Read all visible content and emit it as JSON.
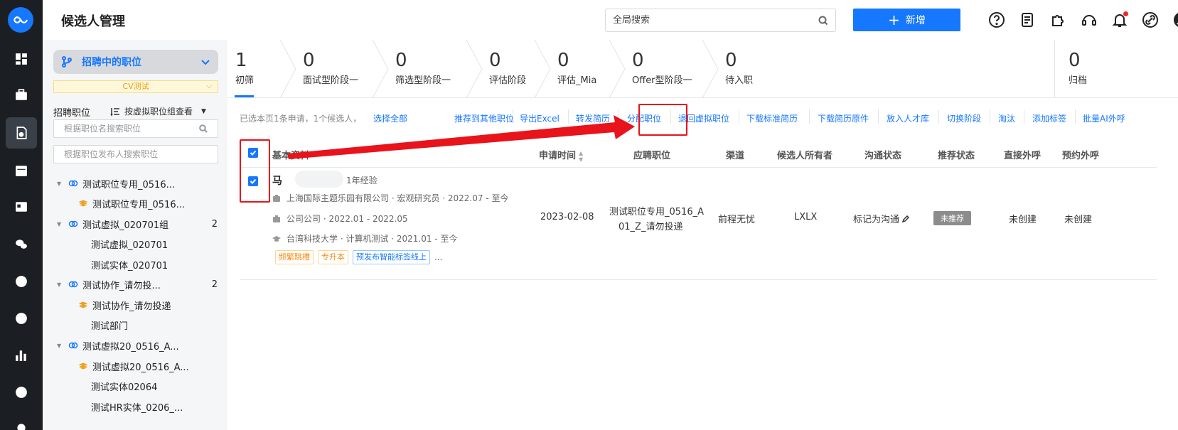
{
  "header": {
    "title": "候选人管理",
    "search_placeholder": "全局搜索",
    "add_label": "新增"
  },
  "left_panel": {
    "position_select": "招聘中的职位",
    "cv_tag": "CV测试",
    "section_label": "招聘职位",
    "group_view": "按虚拟职位组查看",
    "search_name_placeholder": "根据职位名搜索职位",
    "search_publisher_placeholder": "根据职位发布人搜索职位",
    "tree": [
      {
        "label": "测试职位专用_0516...",
        "count": ""
      },
      {
        "label": "测试职位专用_0516...",
        "count": ""
      },
      {
        "label": "测试虚拟_020701组",
        "count": "2"
      },
      {
        "label": "测试虚拟_020701",
        "count": ""
      },
      {
        "label": "测试实体_020701",
        "count": ""
      },
      {
        "label": "测试协作_请勿投...",
        "count": "2"
      },
      {
        "label": "测试协作_请勿投递",
        "count": ""
      },
      {
        "label": "测试部门",
        "count": ""
      },
      {
        "label": "测试虚拟20_0516_A...",
        "count": ""
      },
      {
        "label": "测试虚拟20_0516_A...",
        "count": ""
      },
      {
        "label": "测试实体02064",
        "count": ""
      },
      {
        "label": "测试HR实体_0206_...",
        "count": ""
      }
    ]
  },
  "stages": [
    {
      "num": "1",
      "label": "初筛"
    },
    {
      "num": "0",
      "label": "面试型阶段一"
    },
    {
      "num": "0",
      "label": "筛选型阶段一"
    },
    {
      "num": "0",
      "label": "评估阶段"
    },
    {
      "num": "0",
      "label": "评估_Mia"
    },
    {
      "num": "0",
      "label": "Offer型阶段一"
    },
    {
      "num": "0",
      "label": "待入职"
    },
    {
      "num": "0",
      "label": "归档"
    }
  ],
  "toolbar": {
    "selection_info": "已选本页1条申请，1个候选人，",
    "select_all": "选择全部",
    "actions": [
      "推荐到其他职位",
      "导出Excel",
      "转发简历",
      "分配职位",
      "退回虚拟职位",
      "下载标准简历",
      "下载简历原件",
      "放入人才库",
      "切换阶段",
      "淘汰",
      "添加标签",
      "批量AI外呼"
    ]
  },
  "table": {
    "headers": [
      "基本资料",
      "申请时间",
      "应聘职位",
      "渠道",
      "候选人所有者",
      "沟通状态",
      "推荐状态",
      "直接外呼",
      "预约外呼"
    ],
    "row": {
      "name": "马",
      "experience": "1年经验",
      "work": [
        "上海国际主题乐园有限公司  ·  宏观研究员  ·  2022.07 - 至今",
        "公司公司  ·  2022.01 - 2022.05"
      ],
      "education": "台湾科技大学  ·  计算机测试  ·  2021.01 - 至今",
      "tags": [
        "频繁跳槽",
        "专升本",
        "预发布智能标签线上"
      ],
      "more": "...",
      "apply_date": "2023-02-08",
      "position_line1": "测试职位专用_0516_A",
      "position_line2": "01_Z_请勿投递",
      "channel": "前程无忧",
      "owner": "LXLX",
      "comm_status": "标记为沟通",
      "recommend_status": "未推荐",
      "direct_call": "未创建",
      "scheduled_call": "未创建"
    }
  },
  "colors": {
    "accent": "#1677ff",
    "rail": "#1b1f24",
    "annotation": "#e8131b"
  }
}
